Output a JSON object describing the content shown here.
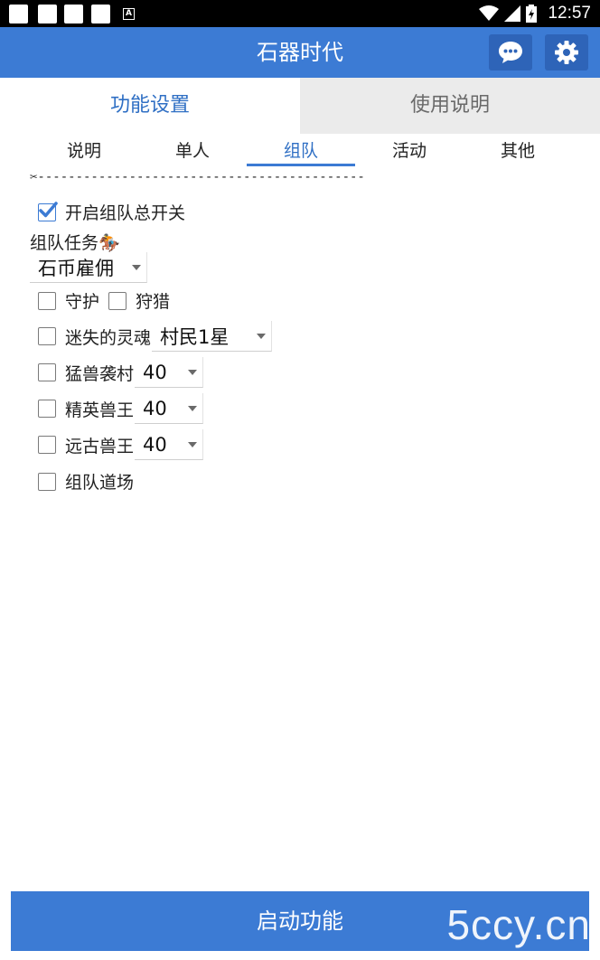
{
  "status_bar": {
    "time": "12:57",
    "notification_badge": "A"
  },
  "header": {
    "title": "石器时代",
    "chat_icon": "chat-bubble-icon",
    "settings_icon": "gear-icon"
  },
  "main_tabs": [
    {
      "label": "功能设置",
      "active": true
    },
    {
      "label": "使用说明",
      "active": false
    }
  ],
  "sub_tabs": [
    {
      "label": "说明",
      "active": false
    },
    {
      "label": "单人",
      "active": false
    },
    {
      "label": "组队",
      "active": true
    },
    {
      "label": "活动",
      "active": false
    },
    {
      "label": "其他",
      "active": false
    }
  ],
  "divider_text": "✂-------------------------------------------",
  "team_master_switch": {
    "label": "开启组队总开关",
    "checked": true
  },
  "team_task": {
    "label": "组队任务🏇",
    "select_value": "石币雇佣"
  },
  "options": {
    "guard": {
      "label": "守护",
      "checked": false
    },
    "hunt": {
      "label": "狩猎",
      "checked": false
    },
    "lost_soul": {
      "label": "迷失的灵魂",
      "checked": false,
      "select_value": "村民1星"
    },
    "beast_raid": {
      "label": "猛兽袭村",
      "checked": false,
      "select_value": "40"
    },
    "elite_beast": {
      "label": "精英兽王",
      "checked": false,
      "select_value": "40"
    },
    "ancient_beast": {
      "label": "远古兽王",
      "checked": false,
      "select_value": "40"
    },
    "team_dojo": {
      "label": "组队道场",
      "checked": false
    }
  },
  "start_button": {
    "label": "启动功能"
  },
  "watermark": "5ccy.cn",
  "colors": {
    "primary": "#3c7bd4",
    "header_button": "#2e64b8",
    "inactive_tab_bg": "#ebebeb",
    "active_text": "#2f6fc4"
  }
}
